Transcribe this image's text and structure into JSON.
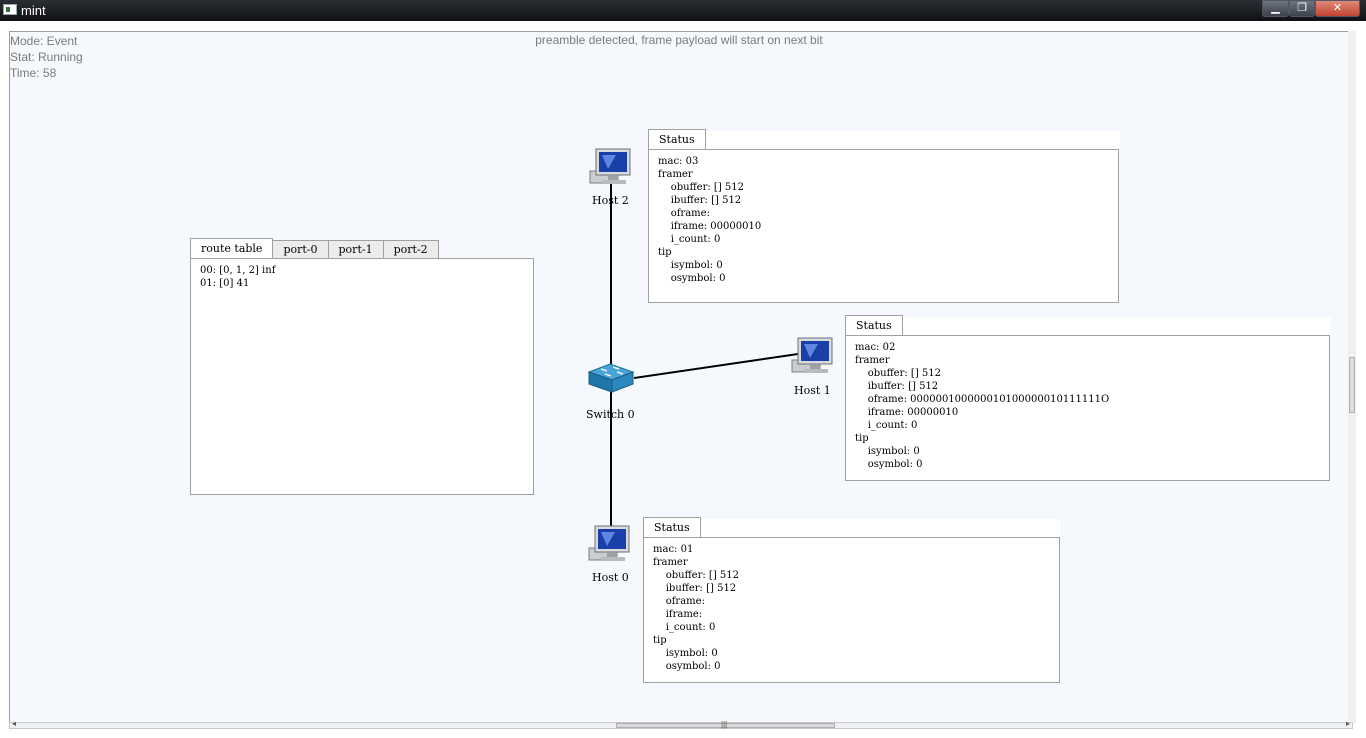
{
  "window": {
    "title": "mint",
    "min": "▁",
    "max": "❐",
    "close": "✕"
  },
  "info": {
    "mode": "Mode: Event",
    "stat": "Stat: Running",
    "time": "Time: 58"
  },
  "banner": "preamble detected, frame payload will start on next bit",
  "route_panel": {
    "tabs": [
      "route table",
      "port-0",
      "port-1",
      "port-2"
    ],
    "lines": [
      "00: [0, 1, 2] inf",
      "01: [0] 41"
    ]
  },
  "nodes": {
    "host2": "Host 2",
    "host1": "Host 1",
    "switch0": "Switch 0",
    "host0": "Host 0"
  },
  "status_host2": {
    "tab": "Status",
    "lines": [
      "mac: 03",
      "framer",
      "    obuffer: [] 512",
      "    ibuffer: [] 512",
      "    oframe:",
      "    iframe: 00000010",
      "    i_count: 0",
      "tip",
      "    isymbol: 0",
      "    osymbol: 0"
    ]
  },
  "status_host1": {
    "tab": "Status",
    "lines": [
      "mac: 02",
      "framer",
      "    obuffer: [] 512",
      "    ibuffer: [] 512",
      "    oframe: 000000100000010100000010111111O",
      "    iframe: 00000010",
      "    i_count: 0",
      "tip",
      "    isymbol: 0",
      "    osymbol: 0"
    ]
  },
  "status_host0": {
    "tab": "Status",
    "lines": [
      "mac: 01",
      "framer",
      "    obuffer: [] 512",
      "    ibuffer: [] 512",
      "    oframe:",
      "    iframe:",
      "    i_count: 0",
      "tip",
      "    isymbol: 0",
      "    osymbol: 0"
    ]
  },
  "icons": {
    "host": "computer-icon",
    "switch": "switch-icon"
  },
  "colors": {
    "canvas_bg": "#f5f8fc",
    "link": "#000000",
    "switch": "#2a7fb0",
    "screen": "#1a3fa8"
  }
}
